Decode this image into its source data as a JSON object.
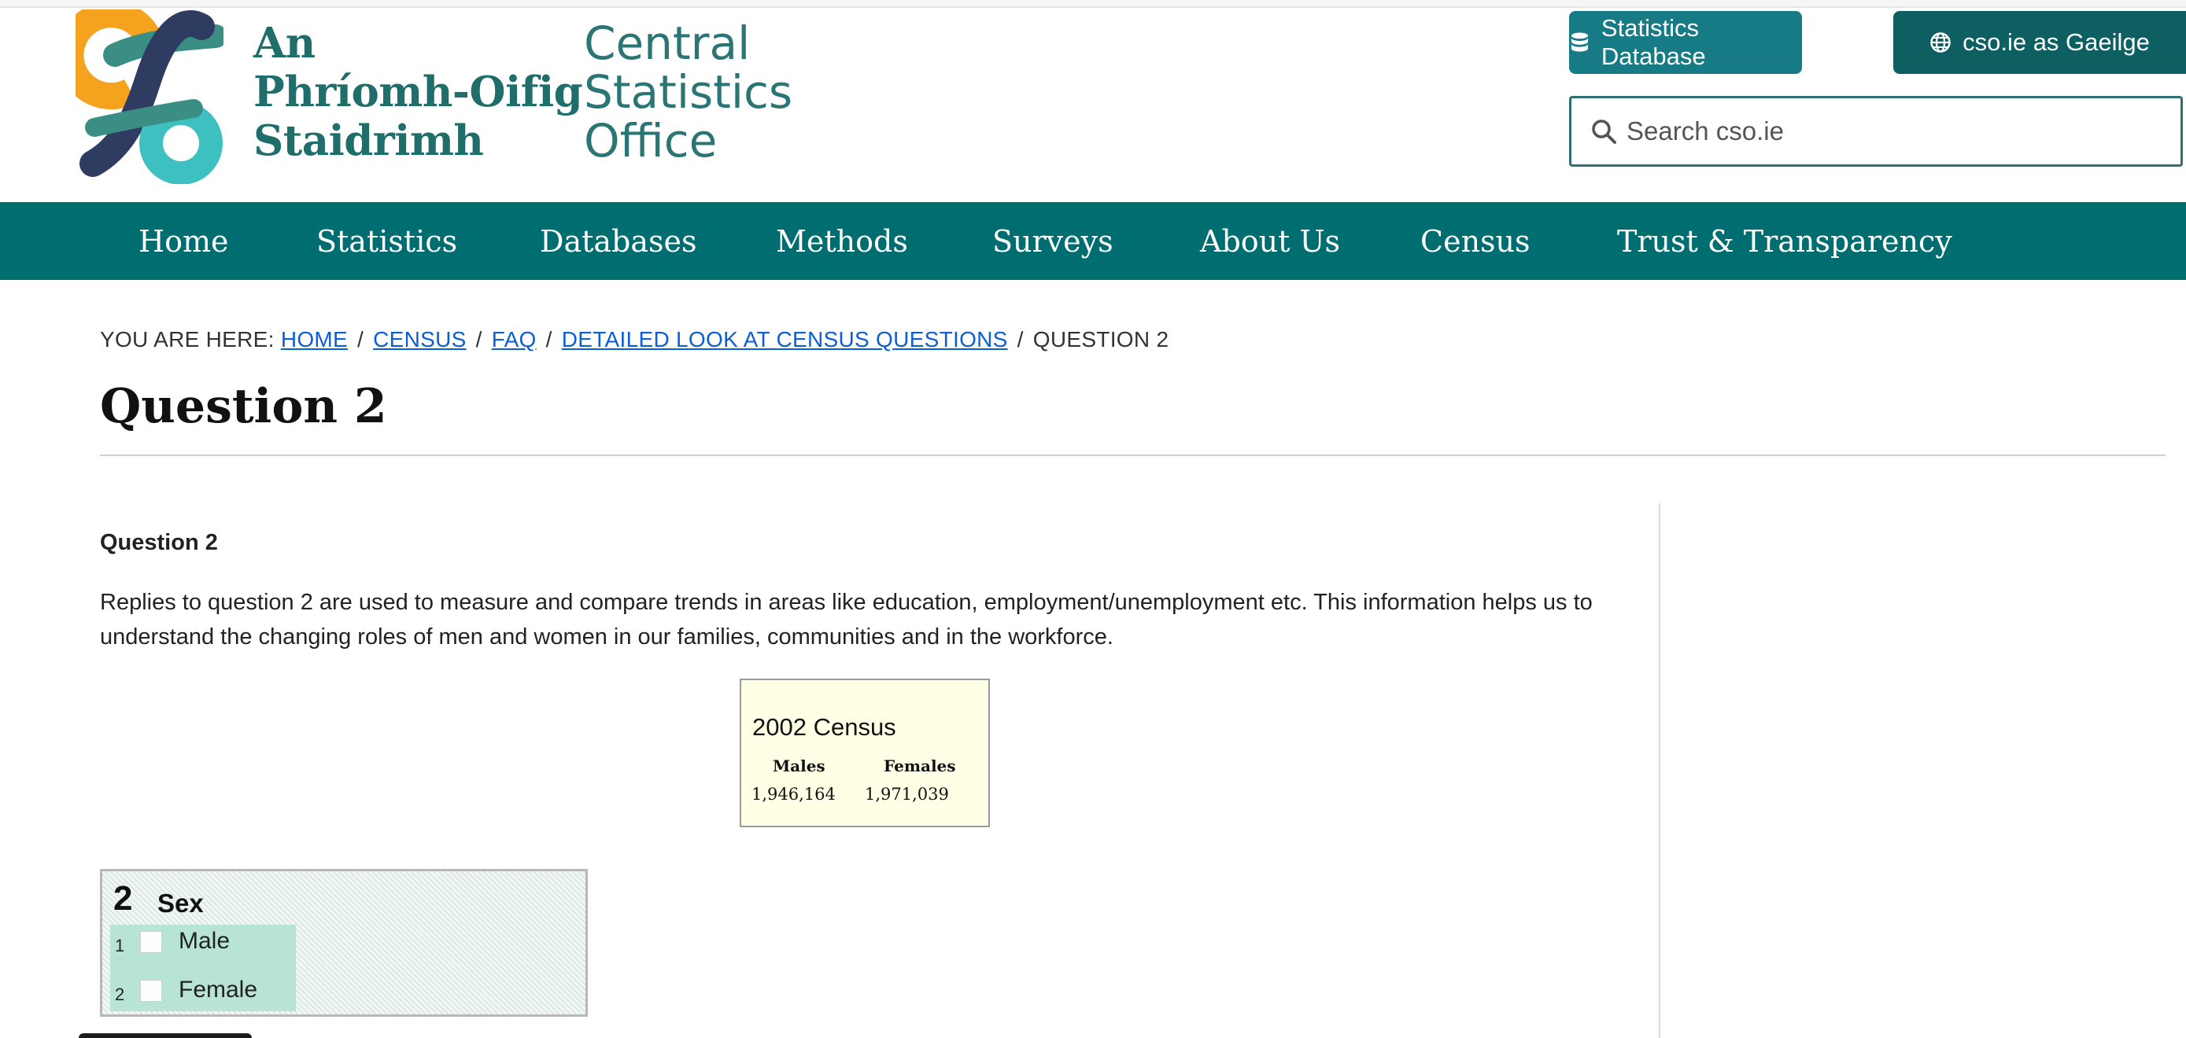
{
  "header": {
    "logo_irish_lines": [
      "An",
      "Phríomh-Oifig",
      "Staidrimh"
    ],
    "logo_english_lines": [
      "Central",
      "Statistics",
      "Office"
    ],
    "buttons": {
      "statistics_database": "Statistics Database",
      "gaeilge": "cso.ie as Gaeilge"
    },
    "search": {
      "placeholder": "Search cso.ie",
      "value": ""
    },
    "icons": {
      "database": "database-icon",
      "globe": "globe-icon",
      "search": "search-icon"
    }
  },
  "nav": {
    "items": [
      {
        "label": "Home"
      },
      {
        "label": "Statistics"
      },
      {
        "label": "Databases"
      },
      {
        "label": "Methods"
      },
      {
        "label": "Surveys"
      },
      {
        "label": "About Us"
      },
      {
        "label": "Census"
      },
      {
        "label": "Trust & Transparency"
      }
    ]
  },
  "breadcrumb": {
    "prefix": "YOU ARE HERE:",
    "links": [
      "HOME",
      "CENSUS",
      "FAQ",
      "DETAILED LOOK AT CENSUS QUESTIONS"
    ],
    "current": "QUESTION 2"
  },
  "page": {
    "title": "Question 2",
    "subheading": "Question 2",
    "paragraph": "Replies to question 2 are used to measure and compare trends in areas like education, employment/unemployment etc. This information helps us to understand the changing roles of men and women in our families, communities and in the workforce."
  },
  "census_box": {
    "title": "2002 Census",
    "columns": [
      {
        "header": "Males",
        "value": "1,946,164"
      },
      {
        "header": "Females",
        "value": "1,971,039"
      }
    ]
  },
  "form_question": {
    "number": "2",
    "label": "Sex",
    "options": [
      {
        "num": "1",
        "label": "Male"
      },
      {
        "num": "2",
        "label": "Female"
      }
    ]
  },
  "colors": {
    "nav_bg": "#006e71",
    "button_db": "#177b86",
    "button_ga": "#0d5f62",
    "link": "#0b5ed7",
    "logo_orange": "#f5a31f",
    "logo_navy": "#2f3c62",
    "logo_teal": "#3fc0c0",
    "logo_green": "#3a8e84"
  }
}
